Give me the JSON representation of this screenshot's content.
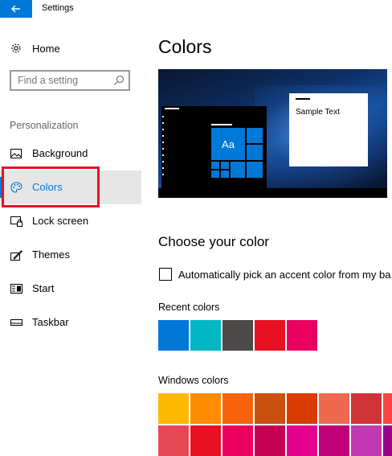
{
  "app": {
    "title": "Settings"
  },
  "back_icon": "arrow-left-icon",
  "sidebar": {
    "home_label": "Home",
    "search_placeholder": "Find a setting",
    "section_label": "Personalization",
    "items": [
      {
        "label": "Background",
        "icon": "picture-icon",
        "active": false
      },
      {
        "label": "Colors",
        "icon": "palette-icon",
        "active": true
      },
      {
        "label": "Lock screen",
        "icon": "lock-screen-icon",
        "active": false
      },
      {
        "label": "Themes",
        "icon": "brush-icon",
        "active": false
      },
      {
        "label": "Start",
        "icon": "start-icon",
        "active": false
      },
      {
        "label": "Taskbar",
        "icon": "taskbar-icon",
        "active": false
      }
    ]
  },
  "main": {
    "title": "Colors",
    "preview": {
      "tile_text": "Aa",
      "window_text": "Sample Text"
    },
    "choose_title": "Choose your color",
    "auto_pick_label": "Automatically pick an accent color from my ba",
    "auto_pick_checked": false,
    "recent_label": "Recent colors",
    "recent_colors": [
      "#0078d7",
      "#00b7c3",
      "#4c4a48",
      "#e81123",
      "#ea005e"
    ],
    "windows_label": "Windows colors",
    "windows_colors_row1": [
      "#ffb900",
      "#ff8c00",
      "#f7630c",
      "#ca5010",
      "#da3b01",
      "#ef6950",
      "#d13438",
      "#ff4343"
    ],
    "windows_colors_row2_partial": [
      "#e74856",
      "#e81123",
      "#ea005e",
      "#c30052",
      "#e3008c",
      "#bf0077",
      "#c239b3",
      "#9a0089"
    ]
  },
  "colors": {
    "accent": "#0078d7",
    "highlight_border": "#e81123",
    "selected_bg": "#e6e6e6"
  }
}
